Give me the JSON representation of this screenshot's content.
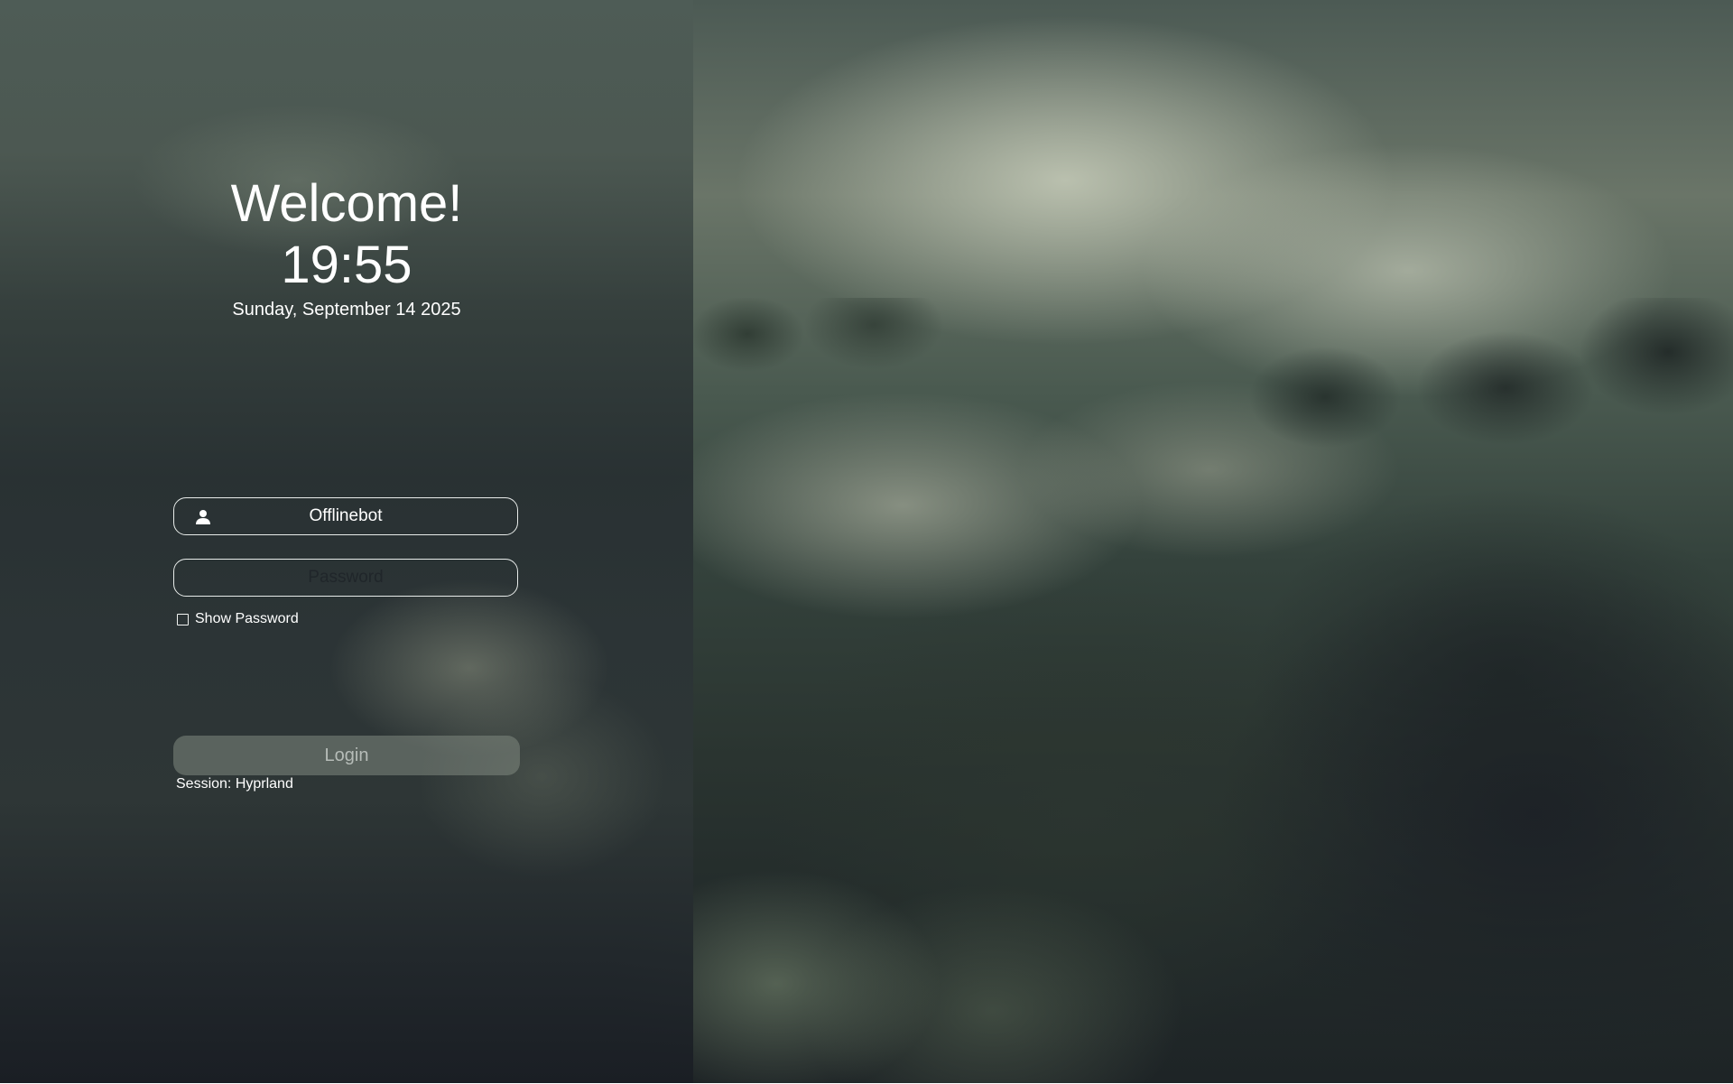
{
  "greeting": "Welcome!",
  "clock": {
    "time": "19:55",
    "date": "Sunday, September 14 2025"
  },
  "login_form": {
    "username": "Offlinebot",
    "password_placeholder": "Password",
    "user_icon": "user-icon",
    "show_password_label": "Show Password",
    "show_password_checked": false,
    "login_label": "Login",
    "session_label": "Session: Hyprland"
  },
  "colors": {
    "text": "#ffffff",
    "field_border": "#e8ecea",
    "login_button_text": "#b6bcb8"
  }
}
